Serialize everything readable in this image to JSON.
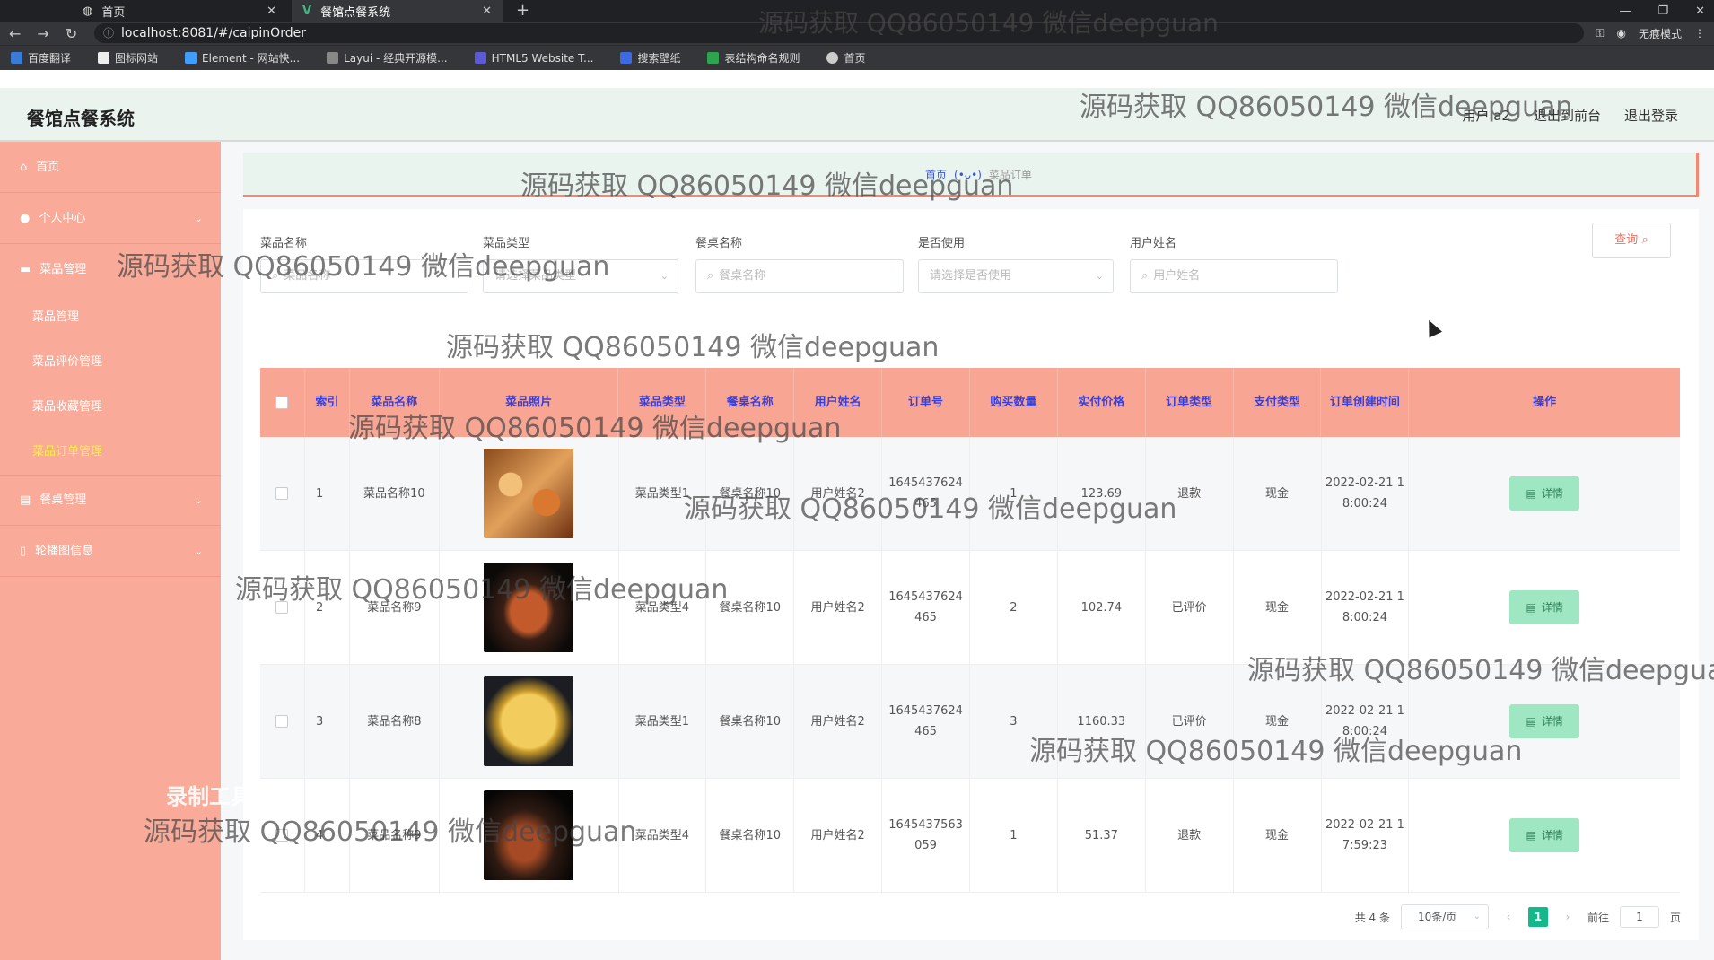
{
  "browser": {
    "tabs": [
      {
        "label": "首页",
        "active": false
      },
      {
        "label": "餐馆点餐系统",
        "active": true
      }
    ],
    "url": "localhost:8081/#/caipinOrder",
    "profile": "无痕模式",
    "bookmarks": [
      "百度翻译",
      "图标网站",
      "Element - 网站快...",
      "Layui - 经典开源模...",
      "HTML5 Website T...",
      "搜索壁纸",
      "表结构命名规则",
      "首页"
    ]
  },
  "header": {
    "title": "餐馆点餐系统",
    "user": "用户 a2",
    "to_front": "退出到前台",
    "logout": "退出登录"
  },
  "sidebar": {
    "items": [
      {
        "label": "首页",
        "icon": "home-icon"
      },
      {
        "label": "个人中心",
        "icon": "user-icon"
      },
      {
        "label": "菜品管理",
        "icon": "menu-icon"
      },
      {
        "label": "菜品管理",
        "sub": true
      },
      {
        "label": "菜品评价管理",
        "sub": true
      },
      {
        "label": "菜品收藏管理",
        "sub": true
      },
      {
        "label": "菜品订单管理",
        "sub": true,
        "active": true
      },
      {
        "label": "餐桌管理",
        "icon": "table-icon"
      },
      {
        "label": "轮播图信息",
        "icon": "image-icon"
      }
    ]
  },
  "breadcrumb": {
    "home": "首页",
    "current": "菜品订单"
  },
  "filters": {
    "name_label": "菜品名称",
    "name_ph": "菜品名称",
    "type_label": "菜品类型",
    "type_ph": "请选择菜品类型",
    "table_label": "餐桌名称",
    "table_ph": "餐桌名称",
    "used_label": "是否使用",
    "used_ph": "请选择是否使用",
    "user_label": "用户姓名",
    "user_ph": "用户姓名",
    "query": "查询"
  },
  "table": {
    "headers": [
      "索引",
      "菜品名称",
      "菜品照片",
      "菜品类型",
      "餐桌名称",
      "用户姓名",
      "订单号",
      "购买数量",
      "实付价格",
      "订单类型",
      "支付类型",
      "订单创建时间",
      "操作"
    ],
    "rows": [
      {
        "idx": "1",
        "name": "菜品名称10",
        "type": "菜品类型1",
        "table": "餐桌名称10",
        "user": "用户姓名2",
        "order": "1645437624465",
        "qty": "1",
        "price": "123.69",
        "otype": "退款",
        "pay": "现金",
        "time": "2022-02-21 18:00:24"
      },
      {
        "idx": "2",
        "name": "菜品名称9",
        "type": "菜品类型4",
        "table": "餐桌名称10",
        "user": "用户姓名2",
        "order": "1645437624465",
        "qty": "2",
        "price": "102.74",
        "otype": "已评价",
        "pay": "现金",
        "time": "2022-02-21 18:00:24"
      },
      {
        "idx": "3",
        "name": "菜品名称8",
        "type": "菜品类型1",
        "table": "餐桌名称10",
        "user": "用户姓名2",
        "order": "1645437624465",
        "qty": "3",
        "price": "1160.33",
        "otype": "已评价",
        "pay": "现金",
        "time": "2022-02-21 18:00:24"
      },
      {
        "idx": "4",
        "name": "菜品名称9",
        "type": "菜品类型4",
        "table": "餐桌名称10",
        "user": "用户姓名2",
        "order": "1645437563059",
        "qty": "1",
        "price": "51.37",
        "otype": "退款",
        "pay": "现金",
        "time": "2022-02-21 17:59:23"
      }
    ],
    "detail_label": "详情"
  },
  "pager": {
    "total": "共 4 条",
    "size": "10条/页",
    "page": "1",
    "goto": "前往",
    "goto_val": "1",
    "unit": "页"
  },
  "watermark": "源码获取 QQ86050149 微信deepguan",
  "recorder": "录制工具"
}
